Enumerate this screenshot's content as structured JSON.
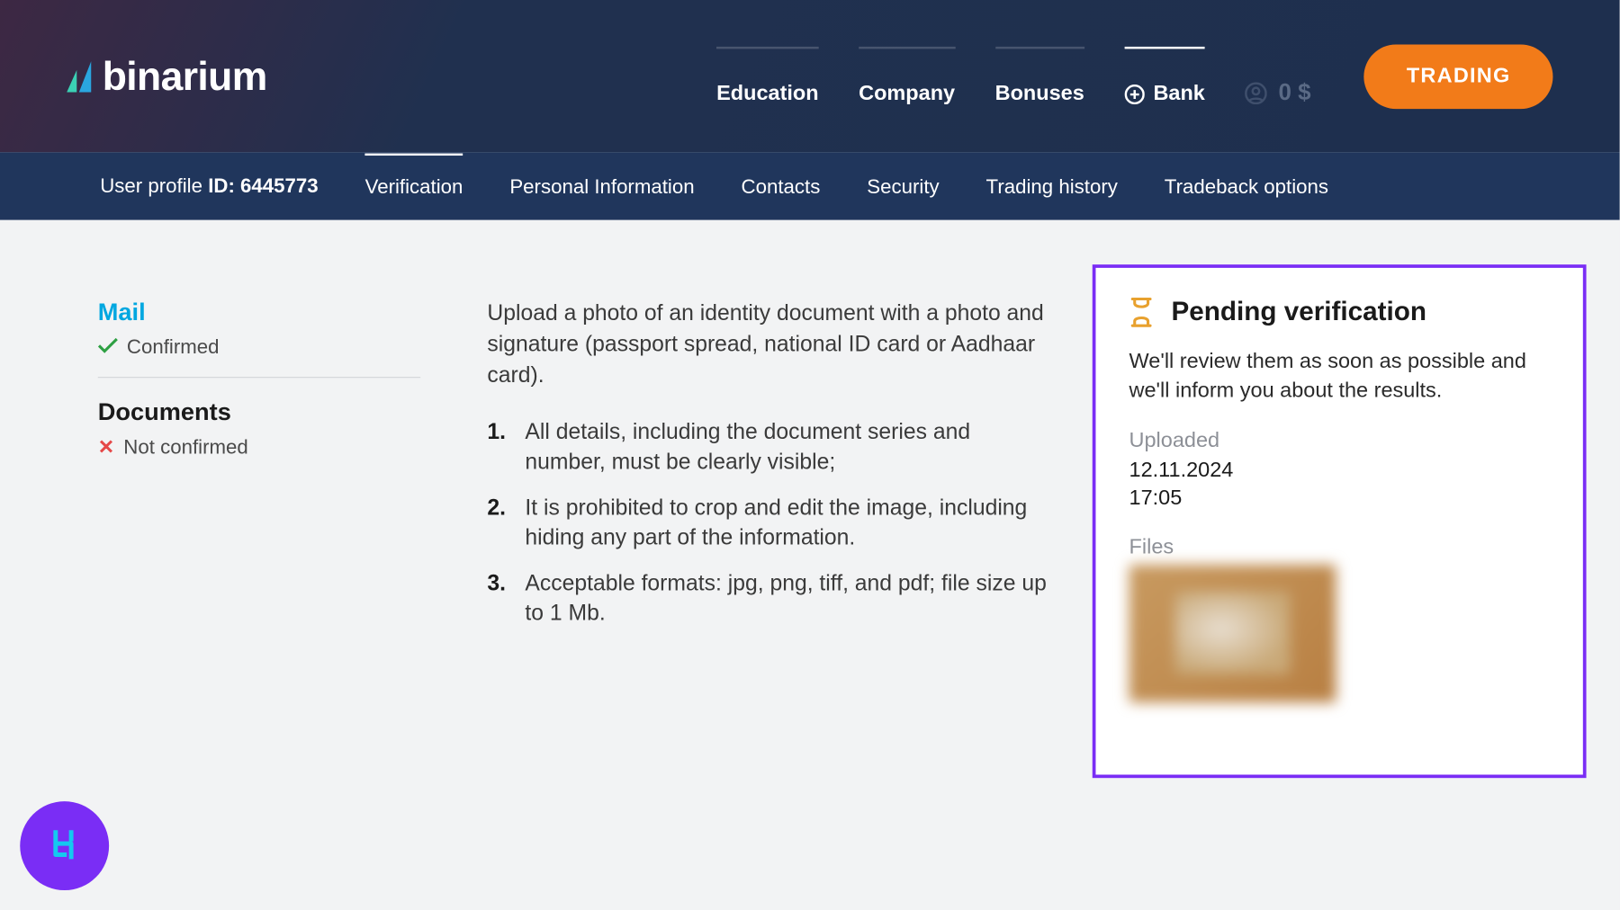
{
  "brand": {
    "name": "binarium"
  },
  "topnav": {
    "education": "Education",
    "company": "Company",
    "bonuses": "Bonuses",
    "bank": "Bank",
    "balance": "0 $",
    "trading": "TRADING"
  },
  "subnav": {
    "profile_label": "User profile",
    "profile_id_label": "ID:",
    "profile_id": "6445773",
    "items": [
      "Verification",
      "Personal Information",
      "Contacts",
      "Security",
      "Trading history",
      "Tradeback options"
    ]
  },
  "left": {
    "mail_title": "Mail",
    "mail_status": "Confirmed",
    "docs_title": "Documents",
    "docs_status": "Not confirmed"
  },
  "instructions": {
    "intro": "Upload a photo of an identity document with a photo and signature (passport spread, national ID card or Aadhaar card).",
    "rules": [
      "All details, including the document series and number, must be clearly visible;",
      "It is prohibited to crop and edit the image, including hiding any part of the information.",
      "Acceptable formats: jpg, png, tiff, and pdf; file size up to 1 Mb."
    ]
  },
  "pending": {
    "title": "Pending verification",
    "desc": "We'll review them as soon as possible and we'll inform you about the results.",
    "uploaded_label": "Uploaded",
    "uploaded_value": "12.11.2024\n17:05",
    "files_label": "Files"
  }
}
